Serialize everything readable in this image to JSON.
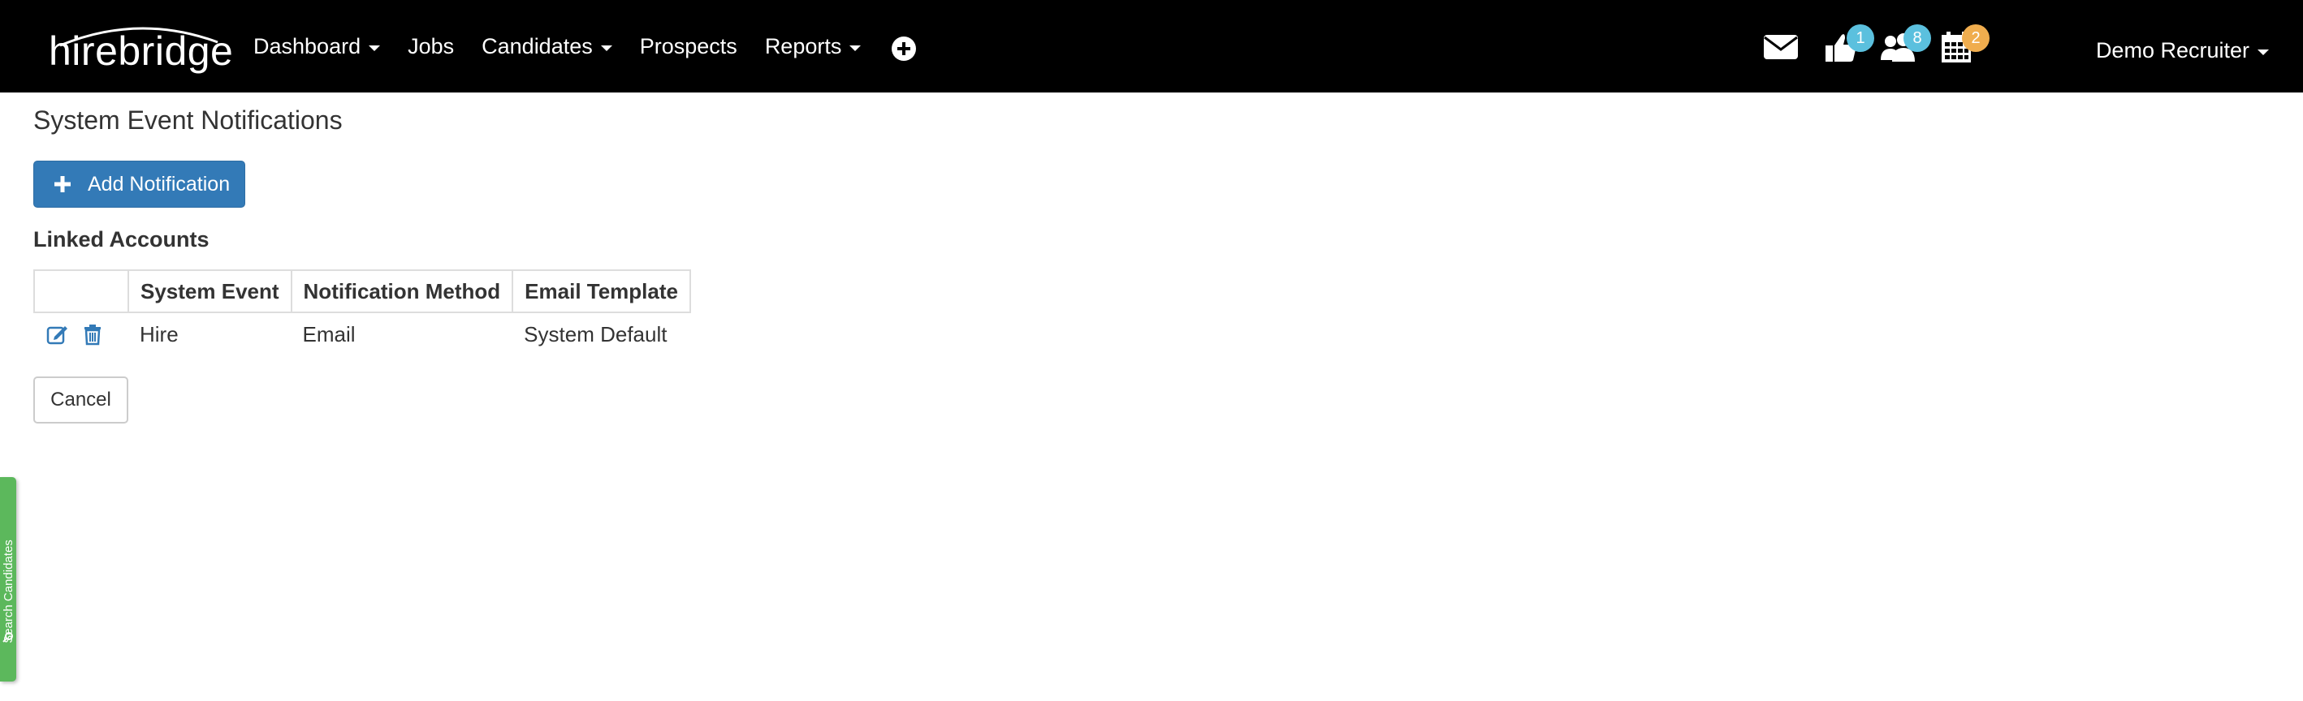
{
  "brand": {
    "name": "hirebridge"
  },
  "nav": {
    "items": [
      {
        "label": "Dashboard",
        "dropdown": true
      },
      {
        "label": "Jobs",
        "dropdown": false
      },
      {
        "label": "Candidates",
        "dropdown": true
      },
      {
        "label": "Prospects",
        "dropdown": false
      },
      {
        "label": "Reports",
        "dropdown": true
      }
    ],
    "add_icon": "plus-circle-icon"
  },
  "notifications": {
    "messages_icon": "envelope-icon",
    "thumbs_badge": "1",
    "people_badge": "8",
    "calendar_badge": "2"
  },
  "user": {
    "name": "Demo Recruiter"
  },
  "page": {
    "title": "System Event Notifications",
    "add_button": "Add Notification",
    "section_title": "Linked Accounts",
    "table": {
      "headers": [
        "",
        "System Event",
        "Notification Method",
        "Email Template"
      ],
      "rows": [
        {
          "system_event": "Hire",
          "notification_method": "Email",
          "email_template": "System Default"
        }
      ]
    },
    "cancel_button": "Cancel"
  },
  "side_tab": {
    "label": "Search Candidates"
  },
  "colors": {
    "navbar_bg": "#000000",
    "primary": "#337ab7",
    "badge_blue": "#5bc0de",
    "badge_orange": "#f0ad4e",
    "side_tab": "#5cb85c"
  }
}
